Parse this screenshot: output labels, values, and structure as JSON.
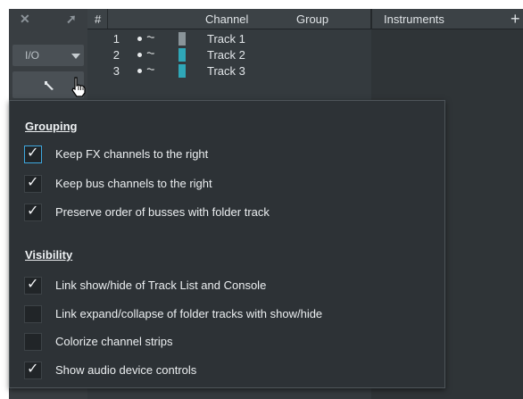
{
  "leftcol": {
    "io_label": "I/O"
  },
  "header": {
    "hash": "#",
    "channel": "Channel",
    "group": "Group",
    "instruments": "Instruments",
    "add": "+"
  },
  "tracks": [
    {
      "num": "1",
      "name": "Track 1",
      "color": "#8a9499"
    },
    {
      "num": "2",
      "name": "Track 2",
      "color": "#2fa7b8"
    },
    {
      "num": "3",
      "name": "Track 3",
      "color": "#2fa7b8"
    }
  ],
  "popup": {
    "grouping": {
      "title": "Grouping",
      "options": [
        {
          "label": "Keep FX channels to the right",
          "checked": true
        },
        {
          "label": "Keep bus channels to the right",
          "checked": true
        },
        {
          "label": "Preserve order of busses with folder track",
          "checked": true
        }
      ]
    },
    "visibility": {
      "title": "Visibility",
      "options": [
        {
          "label": "Link show/hide of Track List and Console",
          "checked": true
        },
        {
          "label": "Link expand/collapse of folder tracks with show/hide",
          "checked": false
        },
        {
          "label": "Colorize channel strips",
          "checked": false
        },
        {
          "label": "Show audio device controls",
          "checked": true
        }
      ]
    }
  }
}
